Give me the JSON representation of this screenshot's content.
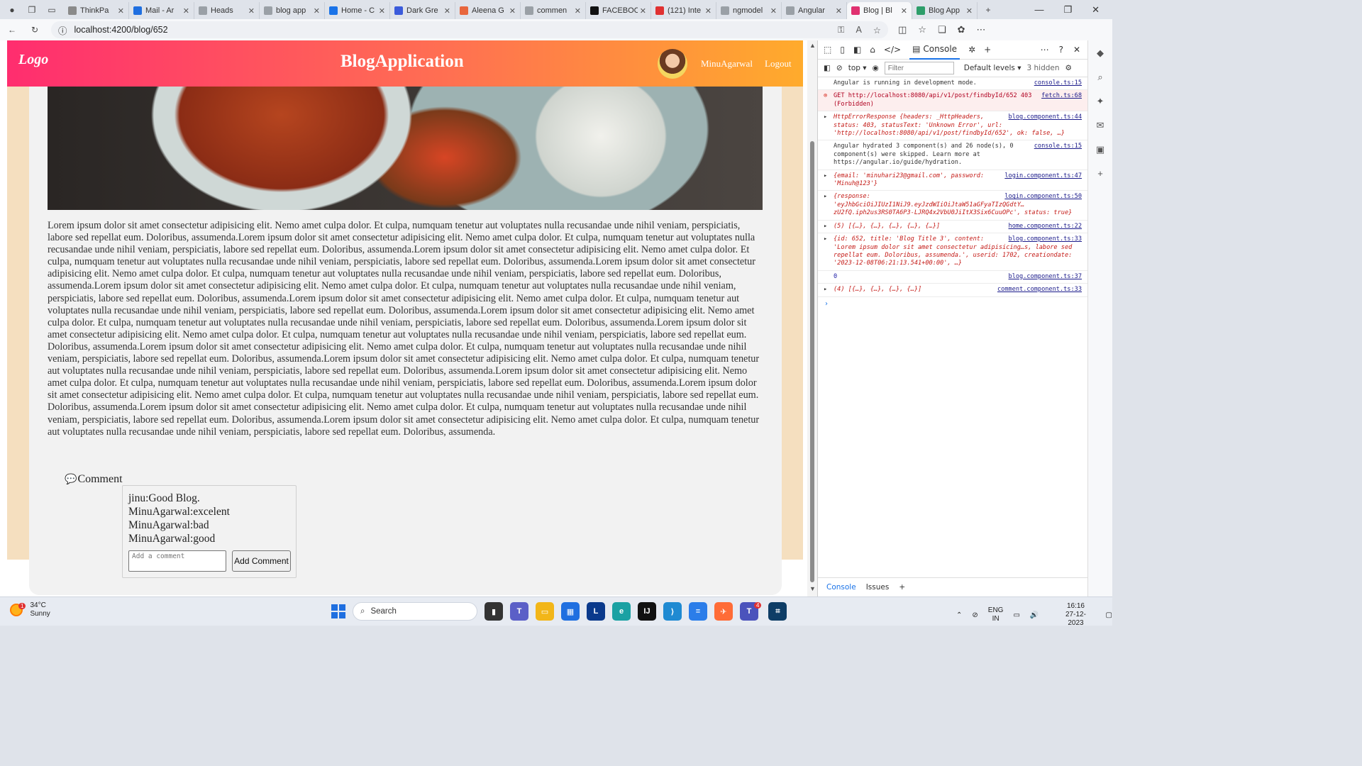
{
  "browser": {
    "tabs": [
      {
        "label": "ThinkPa",
        "color": "#8a8a8a"
      },
      {
        "label": "Mail - Ar",
        "color": "#1f6fe0"
      },
      {
        "label": "Heads",
        "color": "#9aa0a6"
      },
      {
        "label": "blog app",
        "color": "#9aa0a6"
      },
      {
        "label": "Home - C",
        "color": "#1a73e8"
      },
      {
        "label": "Dark Gre",
        "color": "#3b5bdb"
      },
      {
        "label": "Aleena G",
        "color": "#e8663d"
      },
      {
        "label": "commen",
        "color": "#9aa0a6"
      },
      {
        "label": "FACEBOC",
        "color": "#111111"
      },
      {
        "label": "(121) Inte",
        "color": "#e03131"
      },
      {
        "label": "ngmodel",
        "color": "#9aa0a6"
      },
      {
        "label": "Angular",
        "color": "#9aa0a6"
      },
      {
        "label": "Blog | Bl",
        "color": "#e03170"
      },
      {
        "label": "Blog App",
        "color": "#2e9e6a"
      }
    ],
    "url": "localhost:4200/blog/652"
  },
  "page": {
    "logo": "Logo",
    "title": "BlogApplication",
    "user_name": "MinuAgarwal",
    "logout": "Logout",
    "article": "Lorem ipsum dolor sit amet consectetur adipisicing elit. Nemo amet culpa dolor. Et culpa, numquam tenetur aut voluptates nulla recusandae unde nihil veniam, perspiciatis, labore sed repellat eum. Doloribus, assumenda.Lorem ipsum dolor sit amet consectetur adipisicing elit. Nemo amet culpa dolor. Et culpa, numquam tenetur aut voluptates nulla recusandae unde nihil veniam, perspiciatis, labore sed repellat eum. Doloribus, assumenda.Lorem ipsum dolor sit amet consectetur adipisicing elit. Nemo amet culpa dolor. Et culpa, numquam tenetur aut voluptates nulla recusandae unde nihil veniam, perspiciatis, labore sed repellat eum. Doloribus, assumenda.Lorem ipsum dolor sit amet consectetur adipisicing elit. Nemo amet culpa dolor. Et culpa, numquam tenetur aut voluptates nulla recusandae unde nihil veniam, perspiciatis, labore sed repellat eum. Doloribus, assumenda.Lorem ipsum dolor sit amet consectetur adipisicing elit. Nemo amet culpa dolor. Et culpa, numquam tenetur aut voluptates nulla recusandae unde nihil veniam, perspiciatis, labore sed repellat eum. Doloribus, assumenda.Lorem ipsum dolor sit amet consectetur adipisicing elit. Nemo amet culpa dolor. Et culpa, numquam tenetur aut voluptates nulla recusandae unde nihil veniam, perspiciatis, labore sed repellat eum. Doloribus, assumenda.Lorem ipsum dolor sit amet consectetur adipisicing elit. Nemo amet culpa dolor. Et culpa, numquam tenetur aut voluptates nulla recusandae unde nihil veniam, perspiciatis, labore sed repellat eum. Doloribus, assumenda.Lorem ipsum dolor sit amet consectetur adipisicing elit. Nemo amet culpa dolor. Et culpa, numquam tenetur aut voluptates nulla recusandae unde nihil veniam, perspiciatis, labore sed repellat eum. Doloribus, assumenda.Lorem ipsum dolor sit amet consectetur adipisicing elit. Nemo amet culpa dolor. Et culpa, numquam tenetur aut voluptates nulla recusandae unde nihil veniam, perspiciatis, labore sed repellat eum. Doloribus, assumenda.Lorem ipsum dolor sit amet consectetur adipisicing elit. Nemo amet culpa dolor. Et culpa, numquam tenetur aut voluptates nulla recusandae unde nihil veniam, perspiciatis, labore sed repellat eum. Doloribus, assumenda.Lorem ipsum dolor sit amet consectetur adipisicing elit. Nemo amet culpa dolor. Et culpa, numquam tenetur aut voluptates nulla recusandae unde nihil veniam, perspiciatis, labore sed repellat eum. Doloribus, assumenda.Lorem ipsum dolor sit amet consectetur adipisicing elit. Nemo amet culpa dolor. Et culpa, numquam tenetur aut voluptates nulla recusandae unde nihil veniam, perspiciatis, labore sed repellat eum. Doloribus, assumenda.Lorem ipsum dolor sit amet consectetur adipisicing elit. Nemo amet culpa dolor. Et culpa, numquam tenetur aut voluptates nulla recusandae unde nihil veniam, perspiciatis, labore sed repellat eum. Doloribus, assumenda.Lorem ipsum dolor sit amet consectetur adipisicing elit. Nemo amet culpa dolor. Et culpa, numquam tenetur aut voluptates nulla recusandae unde nihil veniam, perspiciatis, labore sed repellat eum. Doloribus, assumenda.",
    "comment_heading": "Comment",
    "comments": [
      "jinu:Good Blog.",
      "MinuAgarwal:excelent",
      "MinuAgarwal:bad",
      "MinuAgarwal:good"
    ],
    "comment_placeholder": "Add a comment",
    "add_comment_button": "Add Comment"
  },
  "devtools": {
    "tabs": {
      "console": "Console"
    },
    "toolbar": {
      "context": "top",
      "filter_placeholder": "Filter",
      "levels": "Default levels",
      "hidden": "3 hidden"
    },
    "bottom_tabs": {
      "console": "Console",
      "issues": "Issues"
    },
    "logs": [
      {
        "type": "info",
        "text": "Angular is running in development mode.",
        "src": "console.ts:15"
      },
      {
        "type": "error",
        "text": "GET http://localhost:8080/api/v1/post/findbyId/652 403 (Forbidden)",
        "src": "fetch.ts:68"
      },
      {
        "type": "object",
        "text": "HttpErrorResponse {headers: _HttpHeaders, status: 403, statusText: 'Unknown Error', url: 'http://localhost:8080/api/v1/post/findbyId/652', ok: false, …}",
        "src": "blog.component.ts:44"
      },
      {
        "type": "info",
        "text": "Angular hydrated 3 component(s) and 26 node(s), 0 component(s) were skipped. Learn more at https://angular.io/guide/hydration.",
        "src": "console.ts:15"
      },
      {
        "type": "object",
        "text": "{email: 'minuhari23@gmail.com', password: 'Minuh@123'}",
        "src": "login.component.ts:47"
      },
      {
        "type": "object",
        "text": "{response: 'eyJhbGciOiJIUzI1NiJ9.eyJzdWIiOiJtaW51aGFyaTIzQGdtY…zU2fQ.iph2us3RS0TA6P3-LJRQ4x2VbU0JiItX3Six6CuuOPc', status: true}",
        "src": "login.component.ts:50"
      },
      {
        "type": "object",
        "text": "(5) [{…}, {…}, {…}, {…}, {…}]",
        "src": "home.component.ts:22"
      },
      {
        "type": "object",
        "text": "{id: 652, title: 'Blog Title 3', content: 'Lorem ipsum dolor sit amet consectetur adipisicing…s, labore sed repellat eum. Doloribus, assumenda.', userid: 1702, creationdate: '2023-12-08T06:21:13.541+00:00', …}",
        "src": "blog.component.ts:33"
      },
      {
        "type": "number",
        "text": "0",
        "src": "blog.component.ts:37"
      },
      {
        "type": "object",
        "text": "(4) [{…}, {…}, {…}, {…}]",
        "src": "comment.component.ts:33"
      }
    ]
  },
  "taskbar": {
    "weather_temp": "34°C",
    "weather_desc": "Sunny",
    "search": "Search",
    "lang": "ENG",
    "region": "IN",
    "time": "16:16",
    "date": "27-12-2023",
    "weather_badge": "1",
    "teams_badge": "4"
  }
}
